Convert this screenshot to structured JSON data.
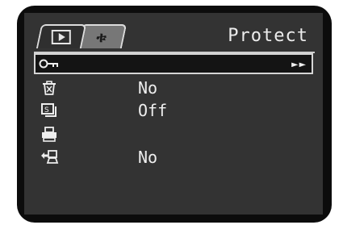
{
  "header": {
    "title": "Protect",
    "tabs": [
      {
        "name": "play-tab",
        "icon": "play-icon"
      },
      {
        "name": "setup-tab",
        "icon": "tools-icon"
      }
    ]
  },
  "menu": {
    "items": [
      {
        "icon": "protect-key-icon",
        "value": "",
        "arrow": "►►"
      },
      {
        "icon": "delete-all-icon",
        "value": "No"
      },
      {
        "icon": "slideshow-icon",
        "value": "Off"
      },
      {
        "icon": "print-order-icon",
        "value": ""
      },
      {
        "icon": "transfer-order-icon",
        "value": "No"
      }
    ]
  }
}
